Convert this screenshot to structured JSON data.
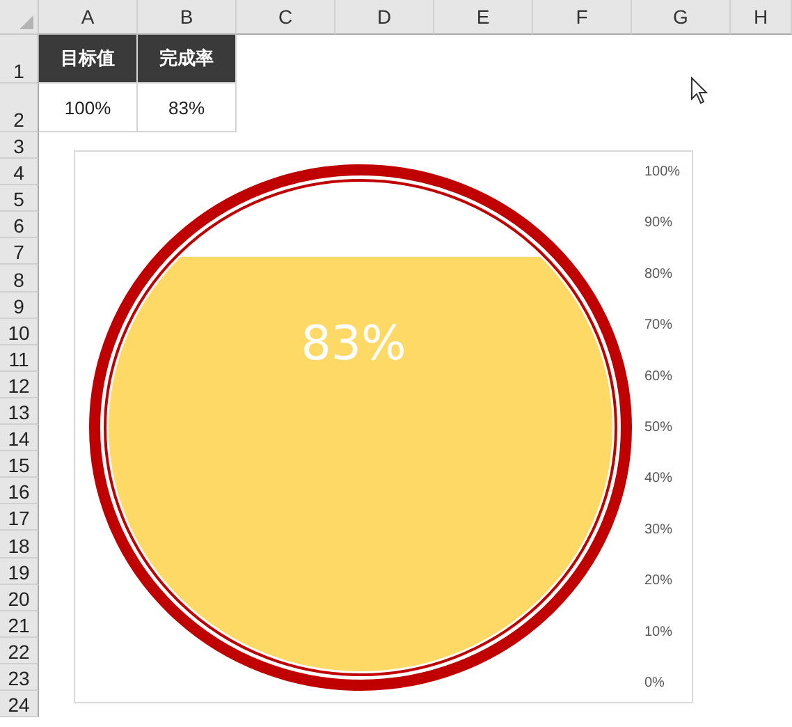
{
  "columns": [
    "A",
    "B",
    "C",
    "D",
    "E",
    "F",
    "G",
    "H"
  ],
  "rows": [
    "1",
    "2",
    "3",
    "4",
    "5",
    "6",
    "7",
    "8",
    "9",
    "10",
    "11",
    "12",
    "13",
    "14",
    "15",
    "16",
    "17",
    "18",
    "19",
    "20",
    "21",
    "22",
    "23",
    "24"
  ],
  "table": {
    "header": [
      "目标值",
      "完成率"
    ],
    "values": [
      "100%",
      "83%"
    ]
  },
  "gauge": {
    "value_label": "83%",
    "scale": [
      "100%",
      "90%",
      "80%",
      "70%",
      "60%",
      "50%",
      "40%",
      "30%",
      "20%",
      "10%",
      "0%"
    ]
  }
}
